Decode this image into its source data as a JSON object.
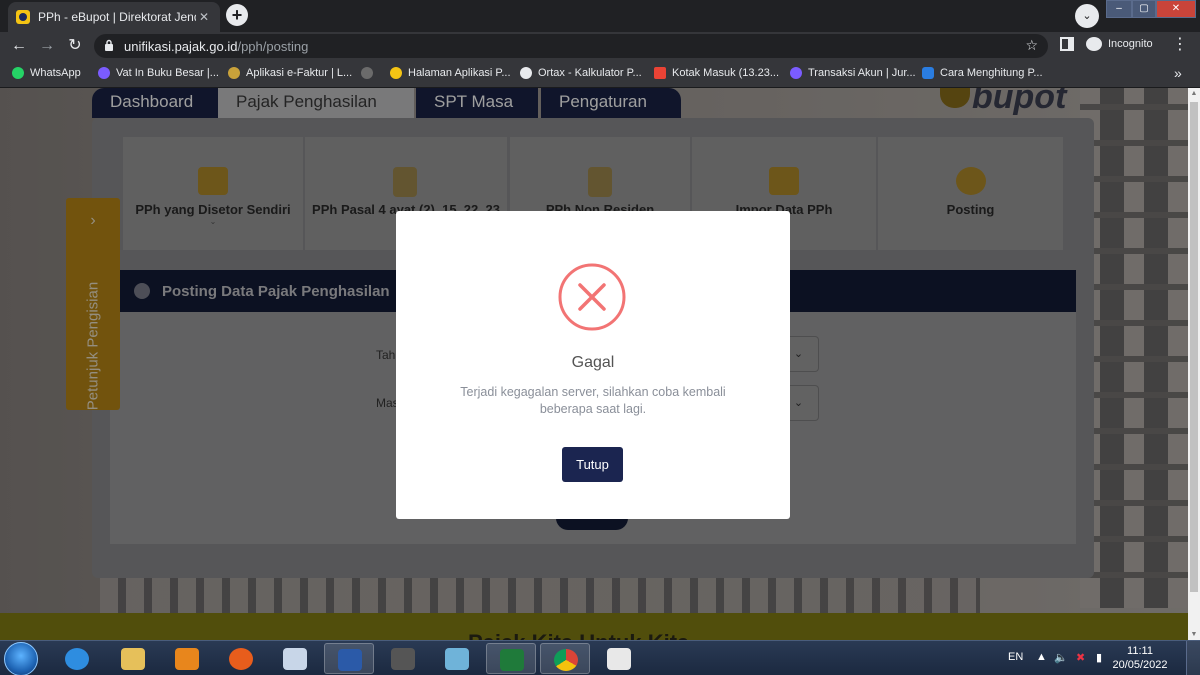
{
  "browser": {
    "tab_title": "PPh - eBupot | Direktorat Jenderal Pajak",
    "tab_close": "✕",
    "new_tab": "+",
    "tab_search": "⌄",
    "window_controls": {
      "minimize": "–",
      "maximize": "▢",
      "close": "✕"
    },
    "back": "←",
    "forward": "→",
    "reload": "↻",
    "url_host": "unifikasi.pajak.go.id",
    "url_path": "/pph/posting",
    "bookmark_star": "☆",
    "incognito_label": "Incognito",
    "menu": "⋮",
    "bookmarks": [
      {
        "label": "WhatsApp",
        "color": "#25d366"
      },
      {
        "label": "Vat In Buku Besar |...",
        "color": "#7b5cff"
      },
      {
        "label": "Aplikasi e-Faktur | L...",
        "color": "#c9a23a"
      },
      {
        "label": "",
        "color": "#6b6b6b"
      },
      {
        "label": "Halaman Aplikasi P...",
        "color": "#f4c414"
      },
      {
        "label": "Ortax - Kalkulator P...",
        "color": "#e8eaed"
      },
      {
        "label": "Kotak Masuk (13.23...",
        "color": "#ea4335"
      },
      {
        "label": "Transaksi Akun | Jur...",
        "color": "#7b5cff"
      },
      {
        "label": "Cara Menghitung P...",
        "color": "#2a7de1"
      }
    ],
    "bookmarks_more": "»"
  },
  "app": {
    "logo_text": "bupot",
    "tabs": [
      {
        "label": "Dashboard",
        "active": false
      },
      {
        "label": "Pajak Penghasilan",
        "active": true
      },
      {
        "label": "SPT Masa",
        "active": false
      },
      {
        "label": "Pengaturan",
        "active": false
      }
    ],
    "menu_cards": [
      {
        "label": "PPh yang Disetor Sendiri",
        "caret": "⌄"
      },
      {
        "label": "PPh Pasal 4 ayat (2), 15, 22, 23",
        "caret": ""
      },
      {
        "label": "PPh Non Residen",
        "caret": ""
      },
      {
        "label": "Impor Data PPh",
        "caret": ""
      },
      {
        "label": "Posting",
        "caret": ""
      }
    ],
    "section_title": "Posting Data Pajak Penghasilan",
    "form": {
      "year_label": "Tah",
      "month_label": "Mas",
      "select_caret": "⌄"
    },
    "side_tab": {
      "label": "Petunjuk Pengisian",
      "chevron": "›"
    },
    "footer_text": "Pajak Kita Untuk Kita"
  },
  "modal": {
    "title": "Gagal",
    "message": "Terjadi kegagalan server, silahkan coba kembali beberapa saat lagi.",
    "button": "Tutup",
    "accent_color": "#f27474"
  },
  "taskbar": {
    "language": "EN",
    "time": "11:11",
    "date": "20/05/2022"
  }
}
